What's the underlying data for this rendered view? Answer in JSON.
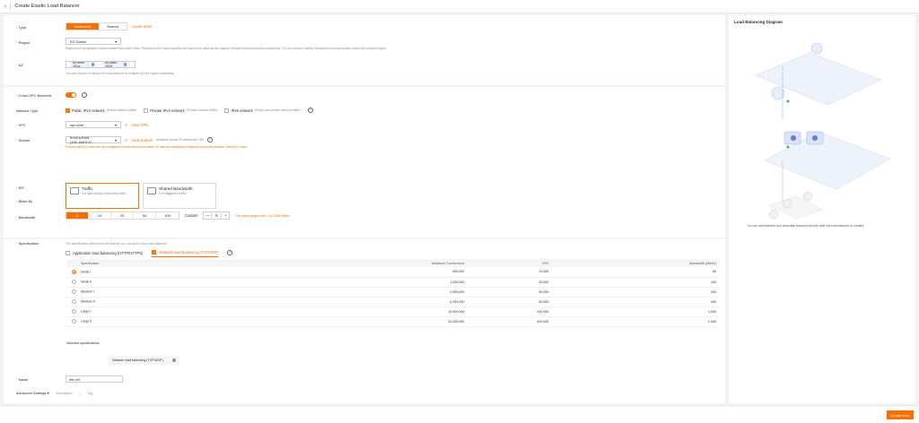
{
  "header": {
    "title": "Create Elastic Load Balancer"
  },
  "type": {
    "label": "Type",
    "options": [
      "Dedicated",
      "Shared"
    ],
    "selected": "Dedicated",
    "learn_more": "Learn more"
  },
  "region": {
    "label": "Region",
    "value": "EU-Dublin",
    "hint": "Regions are geographic areas isolated from each other. Resources are region-specific and cannot be used across regions through internal network connections. For low network latency and quick resource access, select the nearest region."
  },
  "az": {
    "label": "AZ",
    "tags": [
      "eu-west-101a",
      "eu-west-101b"
    ],
    "hint": "You can choose to deploy the load balancer in multiple AZs for higher availability."
  },
  "cross_vpc": {
    "label": "Cross-VPC Backend"
  },
  "network_type": {
    "label": "Network Type",
    "options": [
      {
        "name": "Public IPv4 network",
        "desc": "(Public network traffic)",
        "checked": true
      },
      {
        "name": "Private IPv4 network",
        "desc": "(Private network traffic)",
        "checked": false
      },
      {
        "name": "IPv6 network",
        "desc": "(Public and private network traffic)",
        "checked": false
      }
    ]
  },
  "vpc": {
    "label": "VPC",
    "value": "vpc-sme",
    "link": "View VPC"
  },
  "subnet": {
    "label": "Subnet",
    "value": "front-subnet (192.168.0.0/...",
    "link": "View Subnet",
    "hint": "Available private IP addresses: 180",
    "warn": "Ensure that ACL rules are not configured for the subnet you select. If rules are configured, requests cannot be allowed. View ACL rules"
  },
  "eip": {
    "label": "EIP",
    "options": [
      "New EIP",
      "Use existing"
    ],
    "selected": "New EIP"
  },
  "billed_by": {
    "label": "Billed By",
    "options": [
      {
        "title": "Traffic",
        "desc": "For light/sharply fluctuating traffic",
        "selected": true
      },
      {
        "title": "Shared Bandwidth",
        "desc": "For staggered traffic",
        "selected": false
      }
    ]
  },
  "bandwidth": {
    "label": "Bandwidth",
    "options": [
      "5",
      "10",
      "20",
      "50",
      "100"
    ],
    "selected": "5",
    "custom_label": "Custom",
    "value": "5",
    "warn": "The value ranges from 1 to 2,000 Mbit/s."
  },
  "specification": {
    "label": "Specification",
    "hint": "The specification determines the listener you can add to your load balancer.",
    "types": [
      {
        "name": "Application load balancing (HTTP/HTTPS)",
        "checked": false
      },
      {
        "name": "Network load balancing (TCP/UDP)",
        "checked": true
      }
    ],
    "columns": [
      "Specification",
      "Maximum Connections",
      "CPS",
      "Bandwidth (Mbit/s)"
    ],
    "rows": [
      {
        "spec": "Small I",
        "conn": "500,000",
        "cps": "10,000",
        "bw": "50",
        "selected": true
      },
      {
        "spec": "Small II",
        "conn": "1,000,000",
        "cps": "20,000",
        "bw": "100",
        "selected": false
      },
      {
        "spec": "Medium I",
        "conn": "2,000,000",
        "cps": "40,000",
        "bw": "200",
        "selected": false
      },
      {
        "spec": "Medium II",
        "conn": "4,000,000",
        "cps": "80,000",
        "bw": "400",
        "selected": false
      },
      {
        "spec": "Large I",
        "conn": "10,000,000",
        "cps": "200,000",
        "bw": "1,000",
        "selected": false
      },
      {
        "spec": "Large II",
        "conn": "20,000,000",
        "cps": "400,000",
        "bw": "2,000",
        "selected": false
      }
    ],
    "selected_label": "Selected specifications",
    "selected_value": "Network load balancing (TCP/UDP)",
    "selected_sub": "Small I"
  },
  "name": {
    "label": "Name",
    "value": "elb-vsf"
  },
  "advanced": {
    "label": "Advanced Settings",
    "items": [
      "Description",
      "Tag"
    ]
  },
  "diagram": {
    "title": "Load Balancing Diagram",
    "footnote": "You can add listeners and associate backend servers after the load balancer is created."
  },
  "footer": {
    "create": "Create Now"
  },
  "colors": {
    "accent": "#f66f00",
    "required": "#f66f6a"
  }
}
